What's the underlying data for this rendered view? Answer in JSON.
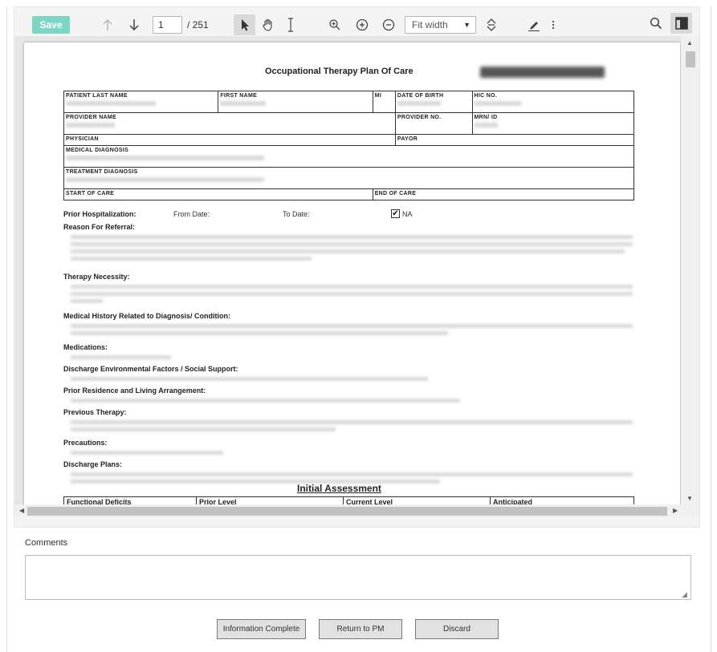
{
  "toolbar": {
    "save_label": "Save",
    "page_current": "1",
    "page_total": "/ 251",
    "zoom_value": "Fit width"
  },
  "document": {
    "title": "Occupational Therapy Plan Of Care",
    "fields": {
      "patient_last_name": "PATIENT LAST NAME",
      "first_name": "FIRST NAME",
      "mi": "MI",
      "date_of_birth": "DATE OF BIRTH",
      "hic_no": "HIC NO.",
      "provider_name": "PROVIDER NAME",
      "provider_no": "PROVIDER NO.",
      "mrn_id": "MRN/ ID",
      "physician": "PHYSICIAN",
      "payor": "PAYOR",
      "medical_diagnosis": "MEDICAL DIAGNOSIS",
      "treatment_diagnosis": "TREATMENT DIAGNOSIS",
      "start_of_care": "START OF CARE",
      "end_of_care": "END OF CARE"
    },
    "prior_hospitalization": "Prior Hospitalization:",
    "from_date": "From Date:",
    "to_date": "To Date:",
    "na_label": "NA",
    "na_checked": "✔",
    "sections": {
      "reason_for_referral": "Reason For Referral:",
      "therapy_necessity": "Therapy Necessity:",
      "medical_history": "Medical History Related to Diagnosis/ Condition:",
      "medications": "Medications:",
      "discharge_env": "Discharge Environmental Factors /  Social Support:",
      "prior_residence": "Prior Residence and Living Arrangement:",
      "previous_therapy": "Previous Therapy:",
      "precautions": "Precautions:",
      "discharge_plans": "Discharge Plans:"
    },
    "initial_assessment": "Initial Assessment",
    "assessment_headers": [
      "Functional Deficits",
      "Prior Level",
      "Current Level",
      "Anticipated"
    ]
  },
  "comments": {
    "label": "Comments",
    "value": ""
  },
  "actions": {
    "information_complete": "Information Complete",
    "return_to_pm": "Return to PM",
    "discard": "Discard"
  },
  "colors": {
    "save_button": "#7dd6c5",
    "toolbar_bg": "#f4f4f4",
    "doc_bg": "#e6e6e6"
  },
  "icons": [
    "arrow-up-icon",
    "arrow-down-icon",
    "pointer-icon",
    "hand-icon",
    "text-cursor-icon",
    "zoom-search-icon",
    "zoom-in-icon",
    "zoom-out-icon",
    "fit-icon",
    "highlight-pen-icon",
    "more-icon",
    "search-icon",
    "sidebar-icon"
  ]
}
